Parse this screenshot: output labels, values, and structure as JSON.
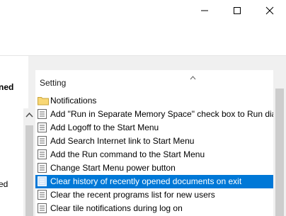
{
  "left_pane": {
    "label_top": "ned",
    "label_bottom": "ed"
  },
  "list": {
    "column_header": "Setting",
    "items": [
      {
        "label": "Notifications",
        "icon": "folder-icon"
      },
      {
        "label": "Add \"Run in Separate Memory Space\" check box to Run dia",
        "icon": "policy-setting-icon"
      },
      {
        "label": "Add Logoff to the Start Menu",
        "icon": "policy-setting-icon"
      },
      {
        "label": "Add Search Internet link to Start Menu",
        "icon": "policy-setting-icon"
      },
      {
        "label": "Add the Run command to the Start Menu",
        "icon": "policy-setting-icon"
      },
      {
        "label": "Change Start Menu power button",
        "icon": "policy-setting-icon"
      },
      {
        "label": "Clear history of recently opened documents on exit",
        "icon": "policy-setting-icon",
        "selected": true
      },
      {
        "label": "Clear the recent programs list for new users",
        "icon": "policy-setting-icon"
      },
      {
        "label": "Clear tile notifications during log on",
        "icon": "policy-setting-icon"
      }
    ]
  },
  "colors": {
    "selection": "#0078d7",
    "folder": "#f8d775"
  }
}
